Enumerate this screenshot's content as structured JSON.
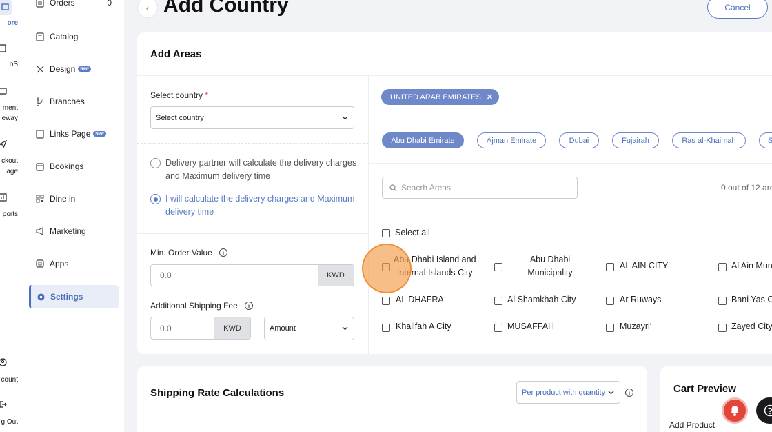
{
  "rail": {
    "items": [
      {
        "label": "ore"
      },
      {
        "label": "oS"
      },
      {
        "label": "ment\neway"
      },
      {
        "label": "ckout\nage"
      },
      {
        "label": "ports"
      },
      {
        "label": "count"
      },
      {
        "label": "g Out"
      }
    ]
  },
  "sidebar": {
    "orders": {
      "label": "Orders",
      "count": "0"
    },
    "items": [
      {
        "label": "Catalog"
      },
      {
        "label": "Design",
        "badge": "New"
      },
      {
        "label": "Branches"
      },
      {
        "label": "Links Page",
        "badge": "New"
      },
      {
        "label": "Bookings"
      },
      {
        "label": "Dine in"
      },
      {
        "label": "Marketing"
      },
      {
        "label": "Apps"
      },
      {
        "label": "Settings"
      }
    ]
  },
  "header": {
    "title": "Add Country",
    "cancel_label": "Cancel"
  },
  "areas_card": {
    "title": "Add Areas",
    "select_country": {
      "label": "Select country",
      "required_mark": "*",
      "value": "Select country"
    },
    "radio_options": [
      {
        "label": "Delivery partner will calculate the delivery charges and Maximum delivery time",
        "selected": false
      },
      {
        "label": "I will calculate the delivery charges and Maximum delivery time",
        "selected": true
      }
    ],
    "min_order": {
      "label": "Min. Order Value",
      "placeholder": "0.0",
      "currency": "KWD"
    },
    "shipping_fee": {
      "label": "Additional Shipping Fee",
      "placeholder": "0.0",
      "currency": "KWD",
      "type_value": "Amount"
    },
    "selected_country_chip": "UNITED ARAB EMIRATES",
    "emirates": [
      {
        "label": "Abu Dhabi Emirate",
        "active": true
      },
      {
        "label": "Ajman Emirate",
        "active": false
      },
      {
        "label": "Dubai",
        "active": false
      },
      {
        "label": "Fujairah",
        "active": false
      },
      {
        "label": "Ras al-Khaimah",
        "active": false
      },
      {
        "label": "S",
        "active": false
      }
    ],
    "search": {
      "placeholder": "Seacrh Areas"
    },
    "selected_count": "0 out of 12 are",
    "select_all_label": "Select all",
    "areas": [
      {
        "label": "Abu Dhabi Island and\nInternal Islands City"
      },
      {
        "label": "Abu Dhabi\nMunicipality"
      },
      {
        "label": "AL AIN CITY"
      },
      {
        "label": "Al Ain Mun"
      },
      {
        "label": "AL DHAFRA"
      },
      {
        "label": "Al Shamkhah City"
      },
      {
        "label": "Ar Ruways"
      },
      {
        "label": "Bani Yas C"
      },
      {
        "label": "Khalifah A City"
      },
      {
        "label": "MUSAFFAH"
      },
      {
        "label": "Muzayri‘"
      },
      {
        "label": "Zayed City"
      }
    ]
  },
  "shipping_card": {
    "title": "Shipping Rate Calculations",
    "mode_value": "Per product with quantity"
  },
  "cart_card": {
    "title": "Cart Preview",
    "add_product_label": "Add Product"
  },
  "colors": {
    "accent": "#5a7cc7",
    "click_marker": "#f39b46",
    "notification": "#e2453a"
  }
}
